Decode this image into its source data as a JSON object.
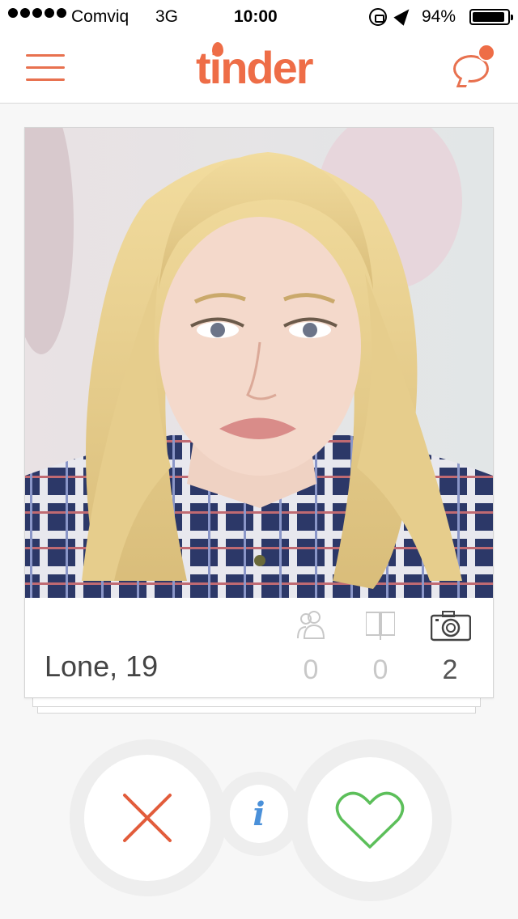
{
  "status_bar": {
    "carrier": "Comviq",
    "network": "3G",
    "time": "10:00",
    "battery_percent": "94%",
    "battery_level": 0.94
  },
  "header": {
    "logo_text": "tinder",
    "menu_icon": "hamburger-menu-icon",
    "chat_icon": "chat-bubble-icon",
    "chat_has_notification": true,
    "accent_color": "#ee6d47"
  },
  "profile_card": {
    "name": "Lone,",
    "age": "19",
    "stats": {
      "shared_friends": "0",
      "shared_interests": "0",
      "photos": "2"
    }
  },
  "actions": {
    "dislike_icon": "x-icon",
    "info_label": "i",
    "like_icon": "heart-icon",
    "dislike_color": "#e25c3b",
    "info_color": "#4a90d9",
    "like_color": "#5cbf5a"
  }
}
